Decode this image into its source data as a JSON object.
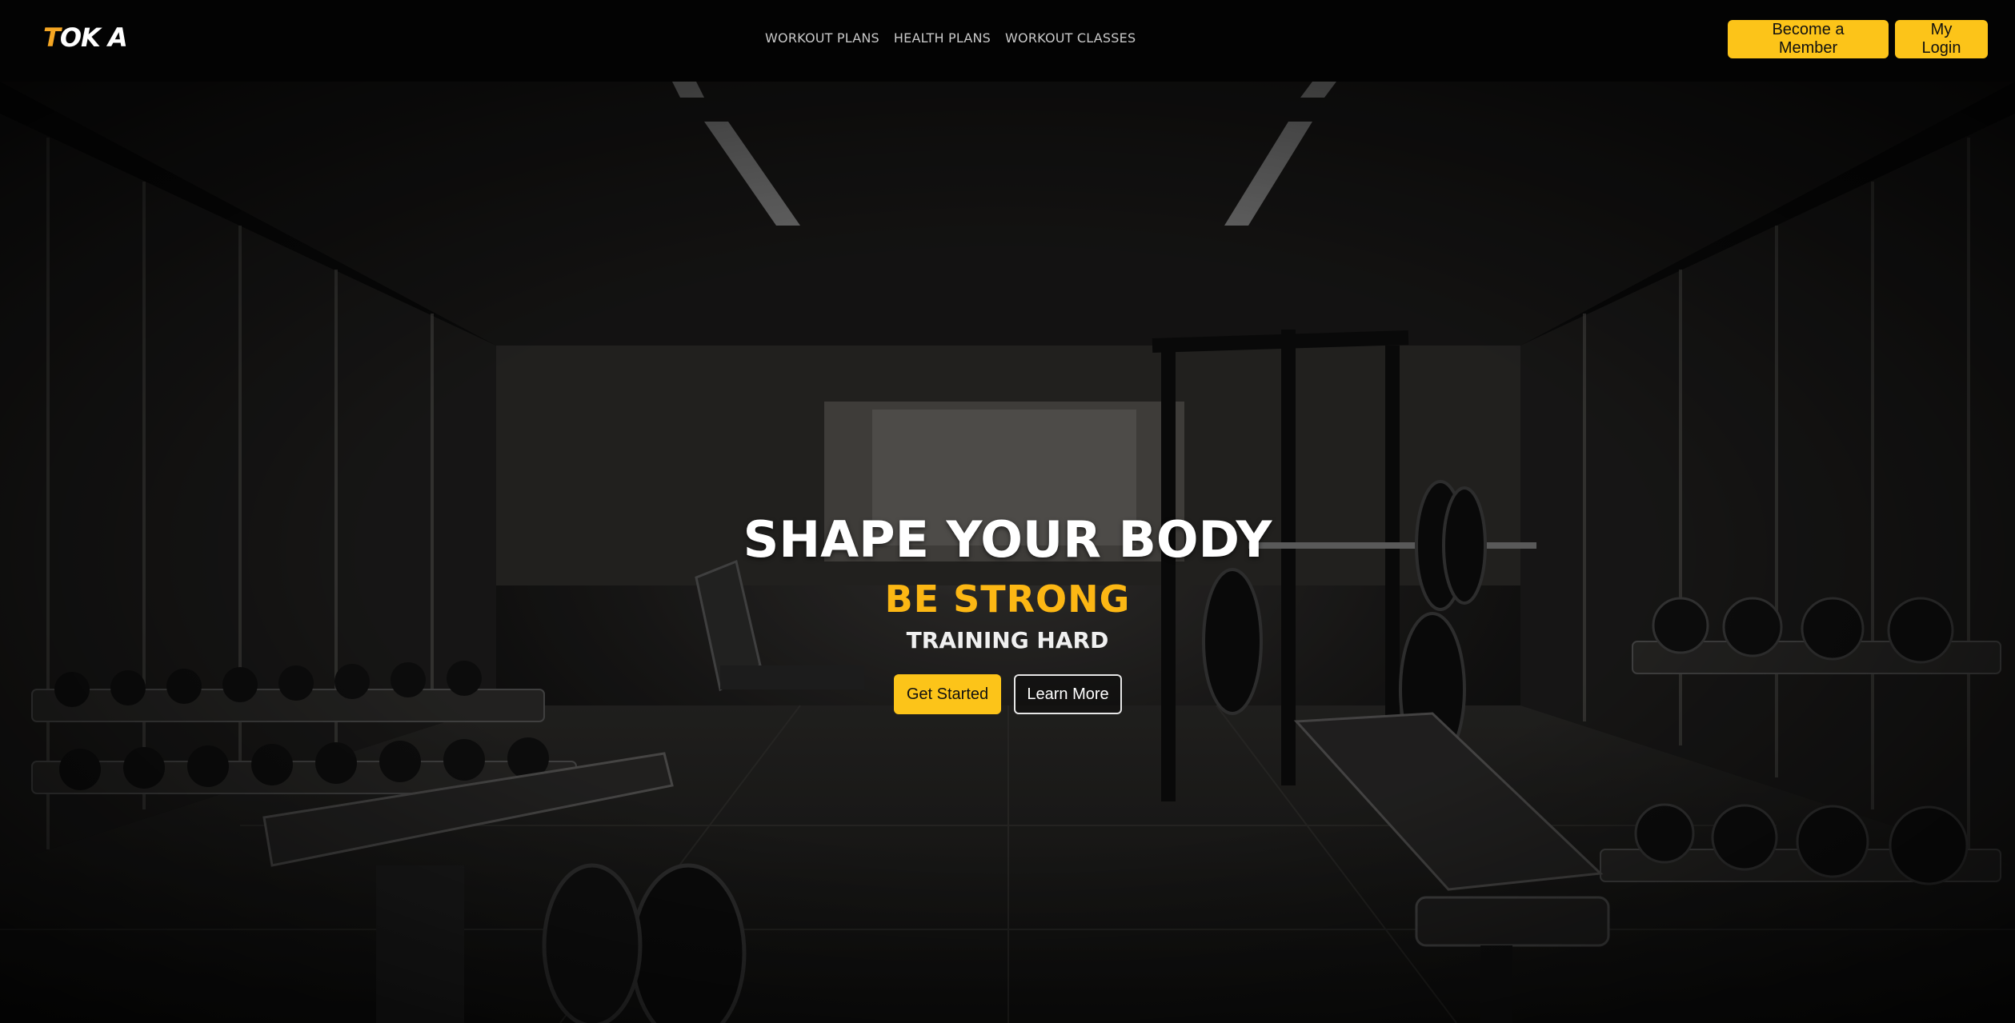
{
  "brand": {
    "logo_first": "T",
    "logo_rest": "OK A"
  },
  "nav": {
    "links": [
      "WORKOUT PLANS",
      "HEALTH PLANS",
      "WORKOUT CLASSES"
    ]
  },
  "header_actions": {
    "member_label": "Become a Member",
    "login_label": "My Login"
  },
  "hero": {
    "headline": "SHAPE YOUR BODY",
    "subhead": "BE STRONG",
    "tagline": "TRAINING HARD",
    "primary_cta": "Get Started",
    "secondary_cta": "Learn More",
    "background_image": "gym-interior-photo"
  },
  "colors": {
    "accent": "#fcc419",
    "accent_text": "#fcb714",
    "navbar": "#030303"
  }
}
